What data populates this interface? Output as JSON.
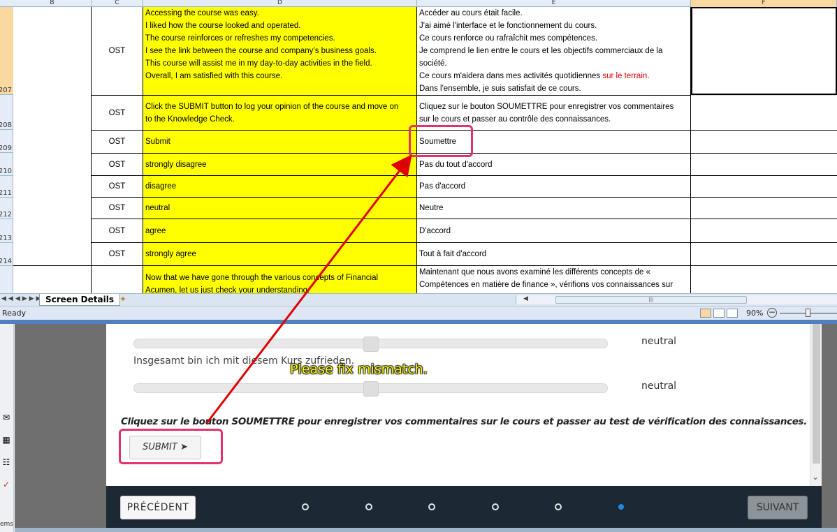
{
  "spreadsheet": {
    "columns": [
      "B",
      "C",
      "D",
      "E",
      "F"
    ],
    "rows": [
      "207",
      "208",
      "209",
      "210",
      "211",
      "212",
      "213",
      "214"
    ],
    "r207": {
      "type": "OST",
      "en": [
        "Accessing the course was easy.",
        "I liked how the course looked and operated.",
        "The course reinforces or refreshes my competencies.",
        "I see the link between the course and company’s business goals.",
        "This course will assist me in my day-to-day activities in the field.",
        "Overall, I am satisfied with this course."
      ],
      "fr": [
        "Accéder au cours était facile.",
        "J'ai aimé l'interface et le fonctionnement du cours.",
        "Ce cours renforce ou rafraîchit mes compétences.",
        "Je comprend le lien entre le cours et les objectifs commerciaux de la",
        "société.",
        "Ce cours m'aidera dans mes activités quotidiennes ",
        "sur le terrain",
        ".",
        "Dans l'ensemble, je suis satisfait de ce cours."
      ]
    },
    "r208": {
      "type": "OST",
      "en": [
        "Click the SUBMIT button to log your opinion of the course and move on",
        "to the Knowledge Check."
      ],
      "fr": [
        "Cliquez sur le bouton SOUMETTRE pour enregistrer vos commentaires",
        "sur le cours et passer au contrôle des connaissances."
      ]
    },
    "r209": {
      "type": "OST",
      "en": "Submit",
      "fr": "Soumettre"
    },
    "r210": {
      "type": "OST",
      "en": "strongly disagree",
      "fr": "Pas du tout d'accord"
    },
    "r211": {
      "type": "OST",
      "en": "disagree",
      "fr": "Pas d'accord"
    },
    "r212": {
      "type": "OST",
      "en": "neutral",
      "fr": "Neutre"
    },
    "r213": {
      "type": "OST",
      "en": "agree",
      "fr": "D'accord"
    },
    "r214": {
      "type": "OST",
      "en": "strongly agree",
      "fr": "Tout à fait d'accord"
    },
    "r215": {
      "en": [
        "Now that we have gone through the various concepts of Financial",
        "Acumen, let us just check your understanding."
      ],
      "fr": [
        "Maintenant que nous avons examiné les différents concepts de «",
        "Compétences en matière de finance », vérifions vos connaissances sur"
      ]
    },
    "sheet_tab": "Screen Details",
    "status": "Ready",
    "zoom": "90%"
  },
  "course": {
    "slider1_value": "neutral",
    "statement": "Insgesamt bin ich mit diesem Kurs zufrieden.",
    "slider2_value": "neutral",
    "instruction": "Cliquez sur le bouton SOUMETTRE pour enregistrer vos commentaires sur le cours et passer au test de vérification des connaissances.",
    "submit_label": "SUBMIT",
    "prev_label": "PRÉCÉDENT",
    "next_label": "SUIVANT",
    "dots_total": 6,
    "dots_active_index": 5,
    "sidebar_label": "ems"
  },
  "annotation": {
    "callout": "Please fix mismatch.",
    "color": "#e4336b",
    "arrow_color": "#e00000"
  }
}
